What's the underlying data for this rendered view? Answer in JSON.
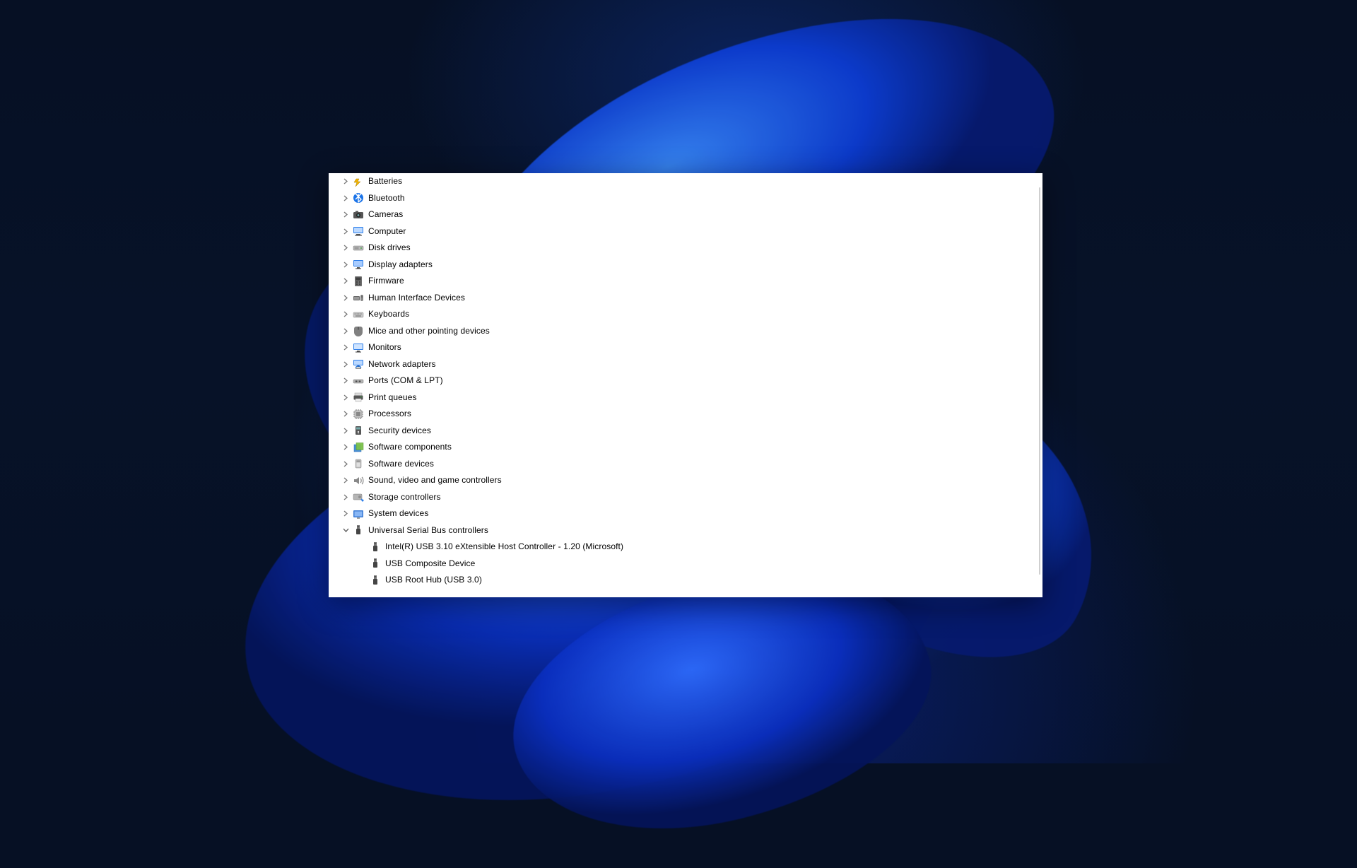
{
  "device_manager": {
    "categories": [
      {
        "label": "Batteries",
        "icon": "battery-icon",
        "expanded": false
      },
      {
        "label": "Bluetooth",
        "icon": "bluetooth-icon",
        "expanded": false
      },
      {
        "label": "Cameras",
        "icon": "camera-icon",
        "expanded": false
      },
      {
        "label": "Computer",
        "icon": "computer-icon",
        "expanded": false
      },
      {
        "label": "Disk drives",
        "icon": "disk-icon",
        "expanded": false
      },
      {
        "label": "Display adapters",
        "icon": "display-icon",
        "expanded": false
      },
      {
        "label": "Firmware",
        "icon": "firmware-icon",
        "expanded": false
      },
      {
        "label": "Human Interface Devices",
        "icon": "hid-icon",
        "expanded": false
      },
      {
        "label": "Keyboards",
        "icon": "keyboard-icon",
        "expanded": false
      },
      {
        "label": "Mice and other pointing devices",
        "icon": "mouse-icon",
        "expanded": false
      },
      {
        "label": "Monitors",
        "icon": "monitor-icon",
        "expanded": false
      },
      {
        "label": "Network adapters",
        "icon": "network-icon",
        "expanded": false
      },
      {
        "label": "Ports (COM & LPT)",
        "icon": "port-icon",
        "expanded": false
      },
      {
        "label": "Print queues",
        "icon": "printer-icon",
        "expanded": false
      },
      {
        "label": "Processors",
        "icon": "cpu-icon",
        "expanded": false
      },
      {
        "label": "Security devices",
        "icon": "security-icon",
        "expanded": false
      },
      {
        "label": "Software components",
        "icon": "software-component-icon",
        "expanded": false
      },
      {
        "label": "Software devices",
        "icon": "software-device-icon",
        "expanded": false
      },
      {
        "label": "Sound, video and game controllers",
        "icon": "sound-icon",
        "expanded": false
      },
      {
        "label": "Storage controllers",
        "icon": "storage-icon",
        "expanded": false
      },
      {
        "label": "System devices",
        "icon": "system-icon",
        "expanded": false
      },
      {
        "label": "Universal Serial Bus controllers",
        "icon": "usb-icon",
        "expanded": true,
        "children": [
          {
            "label": "Intel(R) USB 3.10 eXtensible Host Controller - 1.20 (Microsoft)",
            "icon": "usb-plug-icon"
          },
          {
            "label": "USB Composite Device",
            "icon": "usb-plug-icon"
          },
          {
            "label": "USB Root Hub (USB 3.0)",
            "icon": "usb-plug-icon"
          }
        ]
      }
    ]
  }
}
